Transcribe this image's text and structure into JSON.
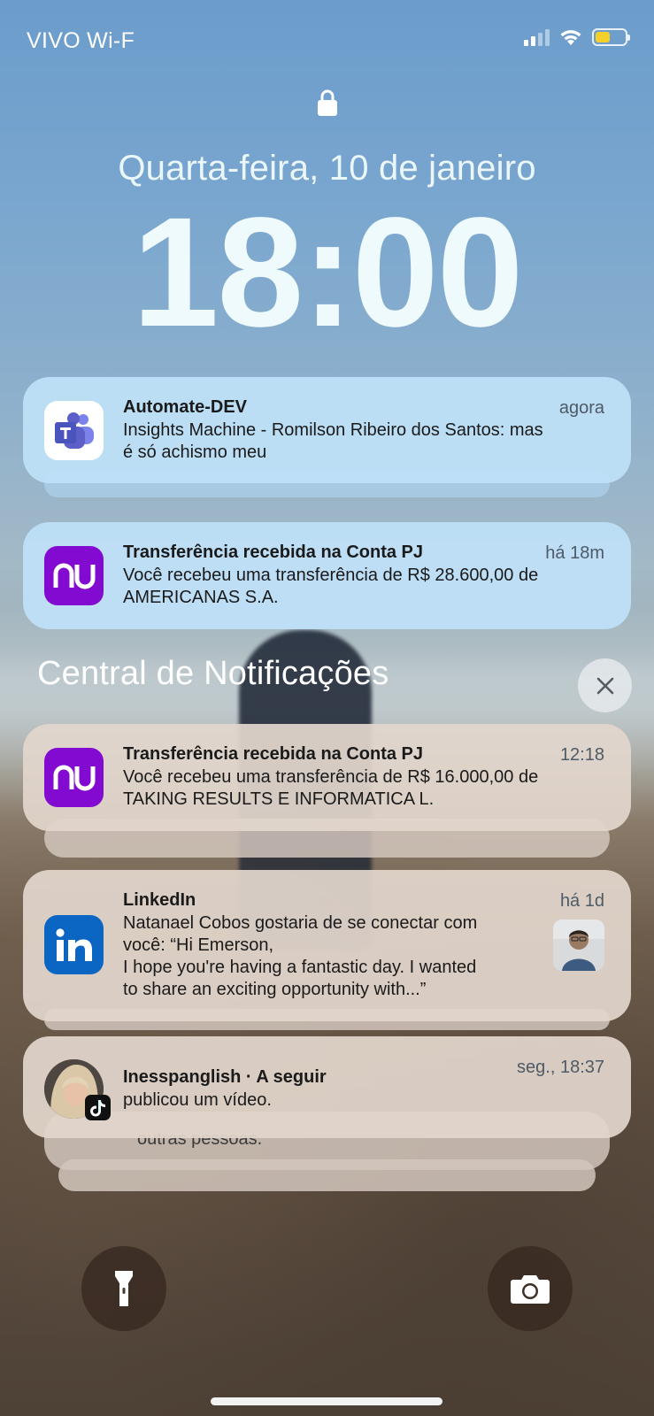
{
  "status_bar": {
    "carrier": "VIVO Wi-F",
    "battery_color": "#f4cf2b"
  },
  "lockscreen": {
    "date": "Quarta-feira, 10 de janeiro",
    "time": "18:00"
  },
  "recent_notifications": [
    {
      "app_icon": "teams-icon",
      "title": "Automate-DEV",
      "time": "agora",
      "body_lines": [
        "Insights Machine - Romilson Ribeiro dos Santos: mas",
        "é só achismo meu"
      ]
    },
    {
      "app_icon": "nubank-icon",
      "title": "Transferência recebida na Conta PJ",
      "time": "há 18m",
      "body_lines": [
        "Você recebeu uma transferência de R$ 28.600,00 de",
        "AMERICANAS S.A."
      ]
    }
  ],
  "notification_center": {
    "title": "Central de Notificações",
    "notifications": [
      {
        "app_icon": "nubank-icon",
        "title": "Transferência recebida na Conta PJ",
        "time": "12:18",
        "body_lines": [
          "Você recebeu uma transferência de R$ 16.000,00 de",
          "TAKING RESULTS E INFORMATICA L."
        ]
      },
      {
        "app_icon": "linkedin-icon",
        "title": "LinkedIn",
        "time": "há 1d",
        "body_lines": [
          "Natanael Cobos gostaria de se conectar com",
          "você: “Hi Emerson,",
          "I hope you're having a fantastic day. I wanted",
          "to share an exciting opportunity with...”"
        ]
      },
      {
        "app_icon": "tiktok-icon",
        "title": "Inesspanglish · A seguir",
        "time": "seg., 18:37",
        "body_lines": [
          "publicou um vídeo."
        ],
        "stacked_peek_text": "outras pessoas."
      }
    ]
  },
  "colors": {
    "teams": "#5b5fc7",
    "nubank": "#820ad1",
    "linkedin": "#0a66c2"
  }
}
